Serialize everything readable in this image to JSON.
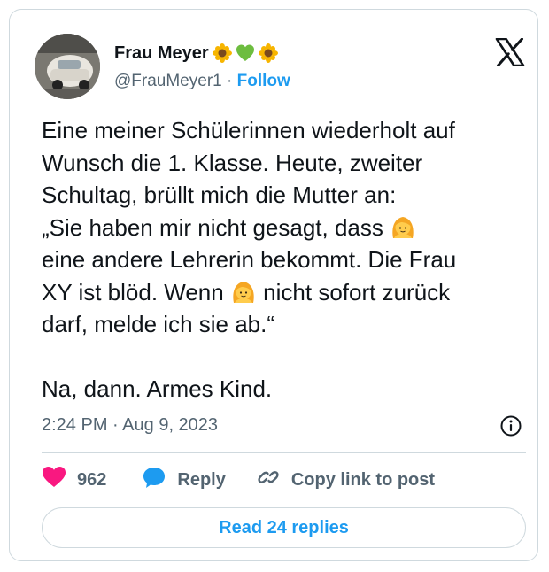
{
  "author": {
    "name": "Frau Meyer",
    "handle": "@FrauMeyer1",
    "separator": "·",
    "follow_label": "Follow",
    "name_emojis": [
      "sunflower-emoji",
      "green-heart-emoji",
      "sunflower-emoji"
    ]
  },
  "tweet": {
    "text_parts": [
      "Eine meiner Schülerinnen wiederholt auf\nWunsch die 1. Klasse. Heute, zweiter\nSchultag, brüllt mich die Mutter an:\n„Sie haben mir nicht gesagt, dass ",
      " \neine andere Lehrerin bekommt. Die Frau\nXY ist blöd. Wenn ",
      " nicht sofort zurück\ndarf, melde ich sie ab.“\n\nNa, dann. Armes Kind."
    ],
    "inline_emoji": "girl-emoji",
    "time": "2:24 PM",
    "date_separator": "·",
    "date": "Aug 9, 2023"
  },
  "actions": {
    "like_count": "962",
    "reply_label": "Reply",
    "copy_label": "Copy link to post"
  },
  "replies_button": "Read 24 replies",
  "colors": {
    "accent": "#1d9bf0",
    "like": "#f91880",
    "text": "#0f1419",
    "muted": "#536471",
    "border": "#cfd9de"
  }
}
